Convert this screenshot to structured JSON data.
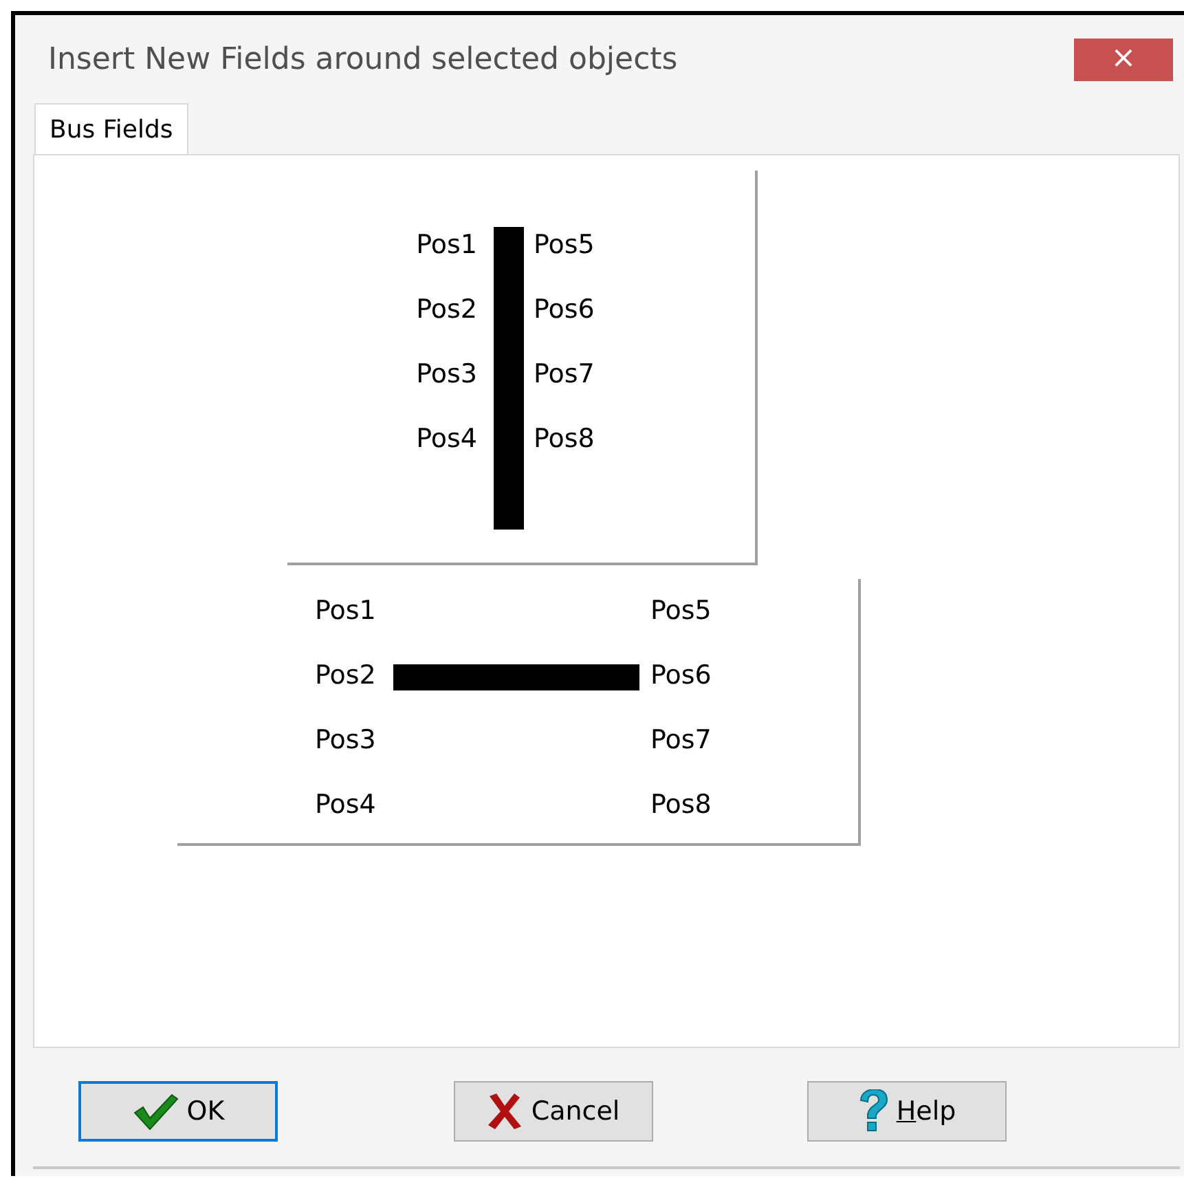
{
  "window": {
    "title": "Insert New Fields around selected objects",
    "close": "×"
  },
  "tabs": [
    {
      "label": "Bus Fields",
      "selected": true
    }
  ],
  "vertical_bus": {
    "left": [
      "Pos1",
      "Pos2",
      "Pos3",
      "Pos4"
    ],
    "right": [
      "Pos5",
      "Pos6",
      "Pos7",
      "Pos8"
    ]
  },
  "horizontal_bus": {
    "left": [
      "Pos1",
      "Pos2",
      "Pos3",
      "Pos4"
    ],
    "right": [
      "Pos5",
      "Pos6",
      "Pos7",
      "Pos8"
    ]
  },
  "buttons": [
    {
      "kind": "ok",
      "label": "OK",
      "default": true,
      "access_key_underlined": false
    },
    {
      "kind": "cancel",
      "label": "Cancel",
      "default": false,
      "access_key_underlined": false
    },
    {
      "kind": "help",
      "label": "Help",
      "default": false,
      "access_key_underlined": true
    }
  ]
}
